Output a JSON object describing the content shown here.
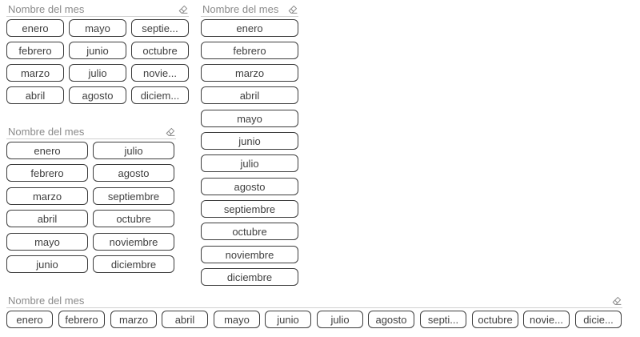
{
  "icons": {
    "clear_filter": "eraser-icon"
  },
  "colors": {
    "title": "#8a8a8a",
    "item_border": "#3c3c3c",
    "item_text": "#404040",
    "divider": "#d0d0d0"
  },
  "slicers": [
    {
      "title": "Nombre del mes",
      "items": [
        "enero",
        "mayo",
        "septie...",
        "febrero",
        "junio",
        "octubre",
        "marzo",
        "julio",
        "novie...",
        "abril",
        "agosto",
        "diciem..."
      ]
    },
    {
      "title": "Nombre del mes",
      "items": [
        "enero",
        "febrero",
        "marzo",
        "abril",
        "mayo",
        "junio",
        "julio",
        "agosto",
        "septiembre",
        "octubre",
        "noviembre",
        "diciembre"
      ]
    },
    {
      "title": "Nombre del mes",
      "items": [
        "enero",
        "julio",
        "febrero",
        "agosto",
        "marzo",
        "septiembre",
        "abril",
        "octubre",
        "mayo",
        "noviembre",
        "junio",
        "diciembre"
      ]
    },
    {
      "title": "Nombre del mes",
      "items": [
        "enero",
        "febrero",
        "marzo",
        "abril",
        "mayo",
        "junio",
        "julio",
        "agosto",
        "septi...",
        "octubre",
        "novie...",
        "dicie..."
      ]
    }
  ]
}
